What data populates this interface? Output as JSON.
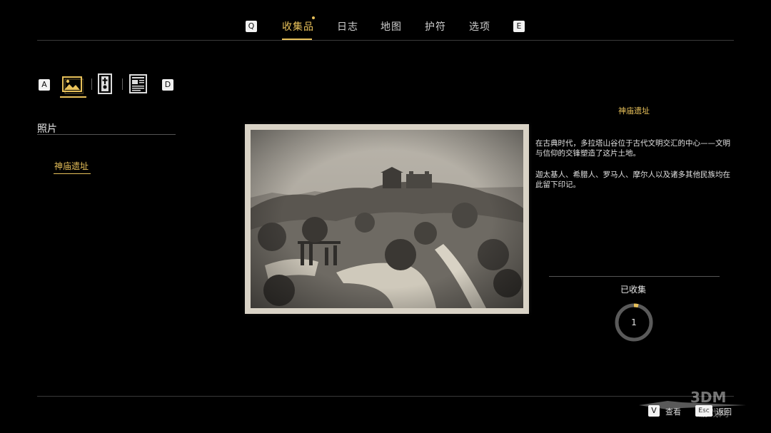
{
  "nav": {
    "left_key": "Q",
    "right_key": "E",
    "tabs": [
      {
        "label": "收集品",
        "active": true
      },
      {
        "label": "日志"
      },
      {
        "label": "地图"
      },
      {
        "label": "护符"
      },
      {
        "label": "选项"
      }
    ]
  },
  "categories": {
    "left_key": "A",
    "right_key": "D",
    "icons": [
      "photo-icon",
      "tombstone-icon",
      "document-icon"
    ]
  },
  "left_panel": {
    "section_title": "照片",
    "items": [
      {
        "label": "神庙遗址",
        "selected": true
      }
    ]
  },
  "detail": {
    "title": "神庙遗址",
    "paragraphs": [
      "在古典时代，多拉塔山谷位于古代文明交汇的中心——文明与信仰的交锋塑造了这片土地。",
      "迦太基人、希腊人、罗马人、摩尔人以及诸多其他民族均在此留下印记。"
    ],
    "collected_label": "已收集",
    "collected_count": "1",
    "progress_fraction": 0.04
  },
  "bottom": {
    "view_key": "V",
    "view_label": "查看",
    "back_key": "Esc",
    "back_label": "返回"
  },
  "watermark": {
    "text": "3DM",
    "sub": "游戏网"
  },
  "colors": {
    "accent": "#e8c15a",
    "background": "#000000"
  }
}
